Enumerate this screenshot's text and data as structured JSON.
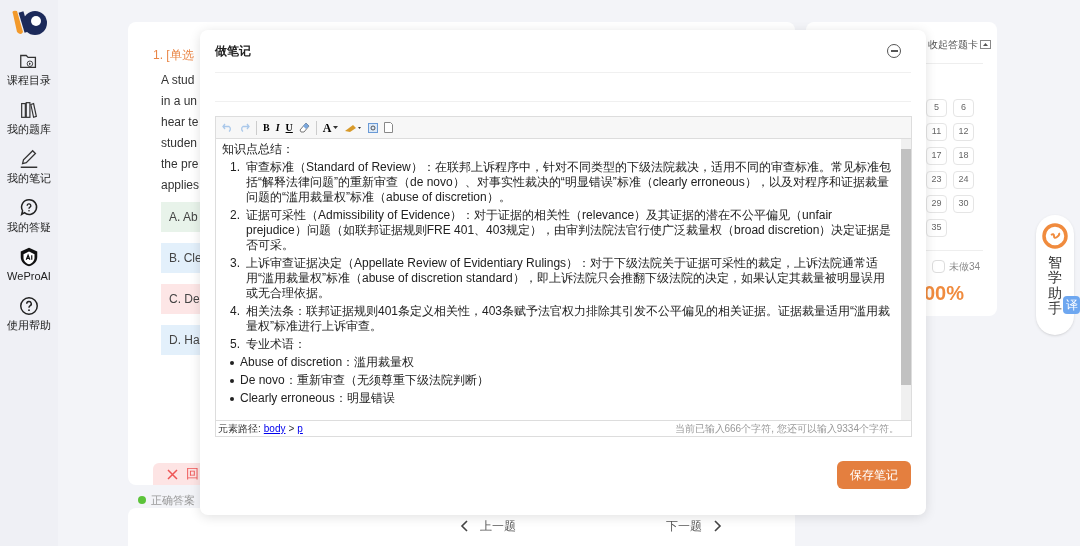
{
  "sidebar": {
    "items": [
      {
        "label": "课程目录",
        "selected": false
      },
      {
        "label": "我的题库",
        "selected": false
      },
      {
        "label": "我的笔记",
        "selected": false
      },
      {
        "label": "我的答疑",
        "selected": false
      },
      {
        "label": "WeProAI",
        "selected": false
      },
      {
        "label": "使用帮助",
        "selected": false
      }
    ]
  },
  "question": {
    "number_label": "1. [单选",
    "lines": [
      "A stud",
      "in a un",
      "hear te",
      "studen",
      "the pre",
      "applies"
    ],
    "options": [
      {
        "label": "A. Ab",
        "color": "#e8f3ea"
      },
      {
        "label": "B. Cle",
        "color": "#e3f0fb"
      },
      {
        "label": "C. De",
        "color": "#fde6e6"
      },
      {
        "label": "D. Ha",
        "color": "#e3f0fb"
      }
    ],
    "result": "回",
    "correct_answer": "正确答案"
  },
  "answer_card": {
    "collapse_label": "收起答题卡",
    "numbers": [
      "5",
      "6",
      "11",
      "12",
      "17",
      "18",
      "23",
      "24",
      "29",
      "30",
      "35"
    ],
    "undone_label": "未做34",
    "score": "00%"
  },
  "navigation": {
    "prev": "上一题",
    "next": "下一题"
  },
  "assistant": {
    "label": "智学助手",
    "translate": "译"
  },
  "note_dialog": {
    "title": "做笔记",
    "toolbar": [
      {
        "kind": "undo",
        "disabled": true
      },
      {
        "kind": "redo",
        "disabled": true
      },
      {
        "kind": "sep"
      },
      {
        "kind": "bold",
        "text": "B"
      },
      {
        "kind": "italic",
        "text": "I"
      },
      {
        "kind": "underline",
        "text": "U"
      },
      {
        "kind": "eraser"
      },
      {
        "kind": "sep"
      },
      {
        "kind": "font-color",
        "text": "A"
      },
      {
        "kind": "highlight"
      },
      {
        "kind": "image"
      },
      {
        "kind": "page"
      }
    ],
    "heading": "知识点总结：",
    "numbered": [
      {
        "marker": "1.",
        "text": "审查标准（Standard of Review）：在联邦上诉程序中，针对不同类型的下级法院裁决，适用不同的审查标准。常见标准包括“解释法律问题”的重新审查（de novo）、对事实性裁决的“明显错误”标准（clearly erroneous），以及对程序和证据裁量问题的“滥用裁量权”标准（abuse of discretion）。"
      },
      {
        "marker": "2.",
        "text": "证据可采性（Admissibility of Evidence）：对于证据的相关性（relevance）及其证据的潜在不公平偏见（unfair prejudice）问题（如联邦证据规则FRE 401、403规定），由审判法院法官行使广泛裁量权（broad discretion）决定证据是否可采。"
      },
      {
        "marker": "3.",
        "text": "上诉审查证据决定（Appellate Review of Evidentiary Rulings）：对于下级法院关于证据可采性的裁定，上诉法院通常适用“滥用裁量权”标准（abuse of discretion standard），即上诉法院只会推翻下级法院的决定，如果认定其裁量被明显误用或无合理依据。"
      },
      {
        "marker": "4.",
        "text": "相关法条：联邦证据规则401条定义相关性，403条赋予法官权力排除其引发不公平偏见的相关证据。证据裁量适用“滥用裁量权”标准进行上诉审查。"
      },
      {
        "marker": "5.",
        "text": "专业术语："
      }
    ],
    "bullets": [
      "Abuse of discretion：滥用裁量权",
      "De novo：重新审查（无须尊重下级法院判断）",
      "Clearly erroneous：明显错误"
    ],
    "path_label": "元素路径:",
    "path": [
      "body",
      "p"
    ],
    "path_separator": ">",
    "char_count": "当前已输入666个字符, 您还可以输入9334个字符。",
    "save": "保存笔记"
  }
}
